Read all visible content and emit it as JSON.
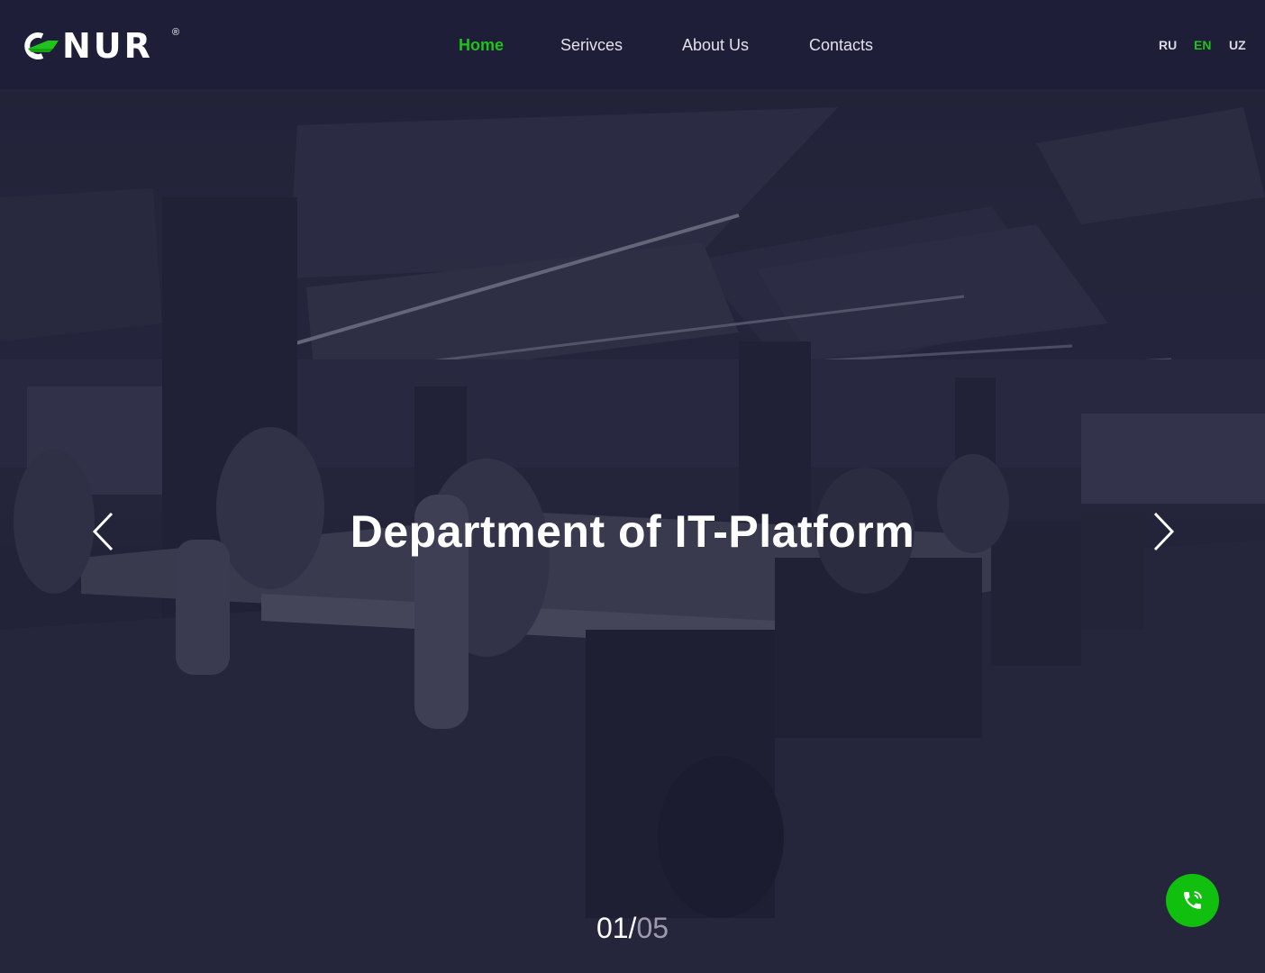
{
  "header": {
    "logo": {
      "text": "NUR",
      "registered_mark": "®"
    },
    "nav": [
      {
        "label": "Home",
        "active": true
      },
      {
        "label": "Serivces",
        "active": false
      },
      {
        "label": "About Us",
        "active": false
      },
      {
        "label": "Contacts",
        "active": false
      }
    ],
    "languages": [
      {
        "code": "RU",
        "active": false
      },
      {
        "code": "EN",
        "active": true
      },
      {
        "code": "UZ",
        "active": false
      }
    ]
  },
  "hero": {
    "title": "Department of IT-Platform",
    "slide": {
      "current": "01",
      "separator": "/",
      "total": "05"
    },
    "prev_icon": "chevron-left-icon",
    "next_icon": "chevron-right-icon",
    "call_icon": "phone-icon"
  },
  "colors": {
    "accent": "#1ec31b",
    "header_bg": "#1e1e38",
    "call_button": "#11bf0e"
  }
}
